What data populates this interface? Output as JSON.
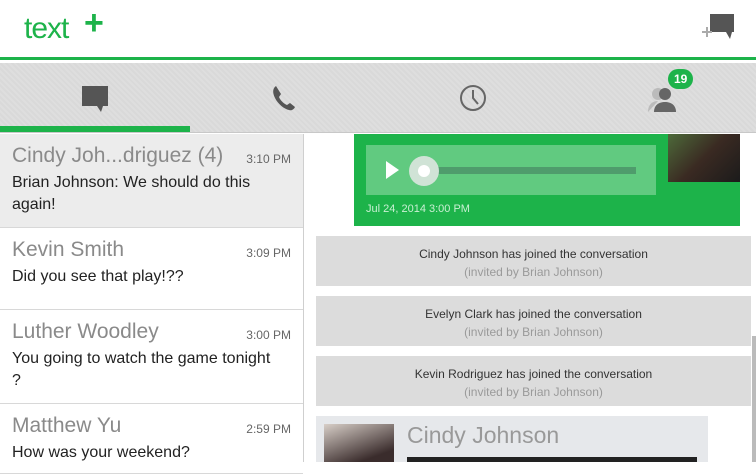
{
  "header": {
    "logo_text": "text",
    "logo_plus": "+"
  },
  "tabs": [
    {
      "name": "messages"
    },
    {
      "name": "calls"
    },
    {
      "name": "history"
    },
    {
      "name": "contacts",
      "badge": "19"
    }
  ],
  "conversations": [
    {
      "name": "Cindy Joh...driguez (4)",
      "time": "3:10 PM",
      "preview": "Brian Johnson: We should do this again!"
    },
    {
      "name": "Kevin Smith",
      "time": "3:09 PM",
      "preview": "Did you see that play!??"
    },
    {
      "name": "Luther Woodley",
      "time": "3:00 PM",
      "preview": "You going to watch the game tonight ?"
    },
    {
      "name": "Matthew Yu",
      "time": "2:59 PM",
      "preview": "How was your weekend?"
    }
  ],
  "chat": {
    "voice_message": {
      "timestamp": "Jul 24, 2014 3:00 PM",
      "progress": 0.0
    },
    "system_messages": [
      {
        "text": "Cindy Johnson has joined the conversation",
        "sub": "(invited by Brian Johnson)"
      },
      {
        "text": "Evelyn Clark has joined the conversation",
        "sub": "(invited by Brian Johnson)"
      },
      {
        "text": "Kevin Rodriguez has joined the conversation",
        "sub": "(invited by Brian Johnson)"
      }
    ],
    "card_name": "Cindy Johnson"
  },
  "colors": {
    "accent": "#1db34a"
  }
}
